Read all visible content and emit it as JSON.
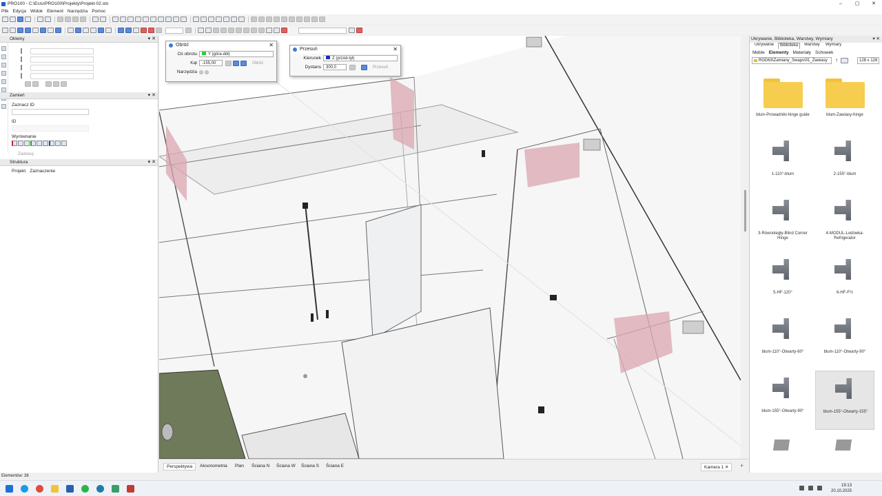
{
  "window": {
    "title": "PRO100 - C:\\Ecru\\PRO100\\Projekty\\Projekt-02.sto",
    "min": "–",
    "max": "▢",
    "close": "✕"
  },
  "menu": [
    "Plik",
    "Edycja",
    "Widok",
    "Element",
    "Narzędzia",
    "Pomoc"
  ],
  "left": {
    "okleiny_title": "Okleiny",
    "zamien_title": "Zamień",
    "zaznacz_id_label": "Zaznacz ID",
    "id_label": "ID",
    "wyrownanie_label": "Wyrównanie",
    "apply_label": "Zastosuj",
    "struktura_title": "Struktura",
    "struktura_tabs": [
      "Projekt",
      "Zaznaczenie"
    ]
  },
  "rotate_dialog": {
    "title": "Obróć",
    "axis_label": "Oś obrotu",
    "axis_value": "Y (góra-dół)",
    "axis_color": "#33cc33",
    "angle_label": "Kąt",
    "angle_value": "-155,00",
    "apply_label": "Obróć",
    "tools_label": "Narzędzia"
  },
  "move_dialog": {
    "title": "Przesuń",
    "direction_label": "Kierunek",
    "direction_value": "Z (przód-tył)",
    "direction_color": "#1a2fb0",
    "distance_label": "Dystans",
    "distance_value": "300,0",
    "apply_label": "Przesuń"
  },
  "views": [
    "Perspektywa",
    "Aksonometria",
    "Plan",
    "Ściana N",
    "Ściana W",
    "Ściana S",
    "Ściana E"
  ],
  "camera_tab": "Kamera 1",
  "right": {
    "title": "Ukrywanie, Biblioteka, Warstwy, Wymiary",
    "tabs": [
      "Ukrywanie",
      "Biblioteka",
      "Warstwy",
      "Wymiary"
    ],
    "subtabs": [
      "Meble",
      "Elementy",
      "Materiały",
      "Schowek"
    ],
    "path": "RGD63\\Zamiany_Swaps\\01_Zawiasy",
    "size": "128 x 128",
    "items": [
      {
        "label": "blum-Prowadniki-hinge guide",
        "kind": "folder"
      },
      {
        "label": "blum-Zawiasy-hinge",
        "kind": "folder"
      },
      {
        "label": "1-110°-blum",
        "kind": "hinge"
      },
      {
        "label": "2-155°-blum",
        "kind": "hinge"
      },
      {
        "label": "3-Równoległy-Blind Corner Hinge",
        "kind": "hinge"
      },
      {
        "label": "4-MODUL-Lodówka-Refrigerator",
        "kind": "hinge"
      },
      {
        "label": "5-HF-120°",
        "kind": "hinge"
      },
      {
        "label": "6-HF-F½",
        "kind": "hinge"
      },
      {
        "label": "blum-110°-Otwarty-60°",
        "kind": "hinge"
      },
      {
        "label": "blum-110°-Otwarty-90°",
        "kind": "hinge"
      },
      {
        "label": "blum-155°-Otwarty-90°",
        "kind": "hinge"
      },
      {
        "label": "blum-155°-Otwarty-155°",
        "kind": "hinge",
        "selected": true
      },
      {
        "label": "",
        "kind": "blum"
      },
      {
        "label": "",
        "kind": "blum"
      }
    ]
  },
  "status": "Elementów: 38",
  "clock": {
    "time": "19:13",
    "date": "20.10.2025"
  }
}
